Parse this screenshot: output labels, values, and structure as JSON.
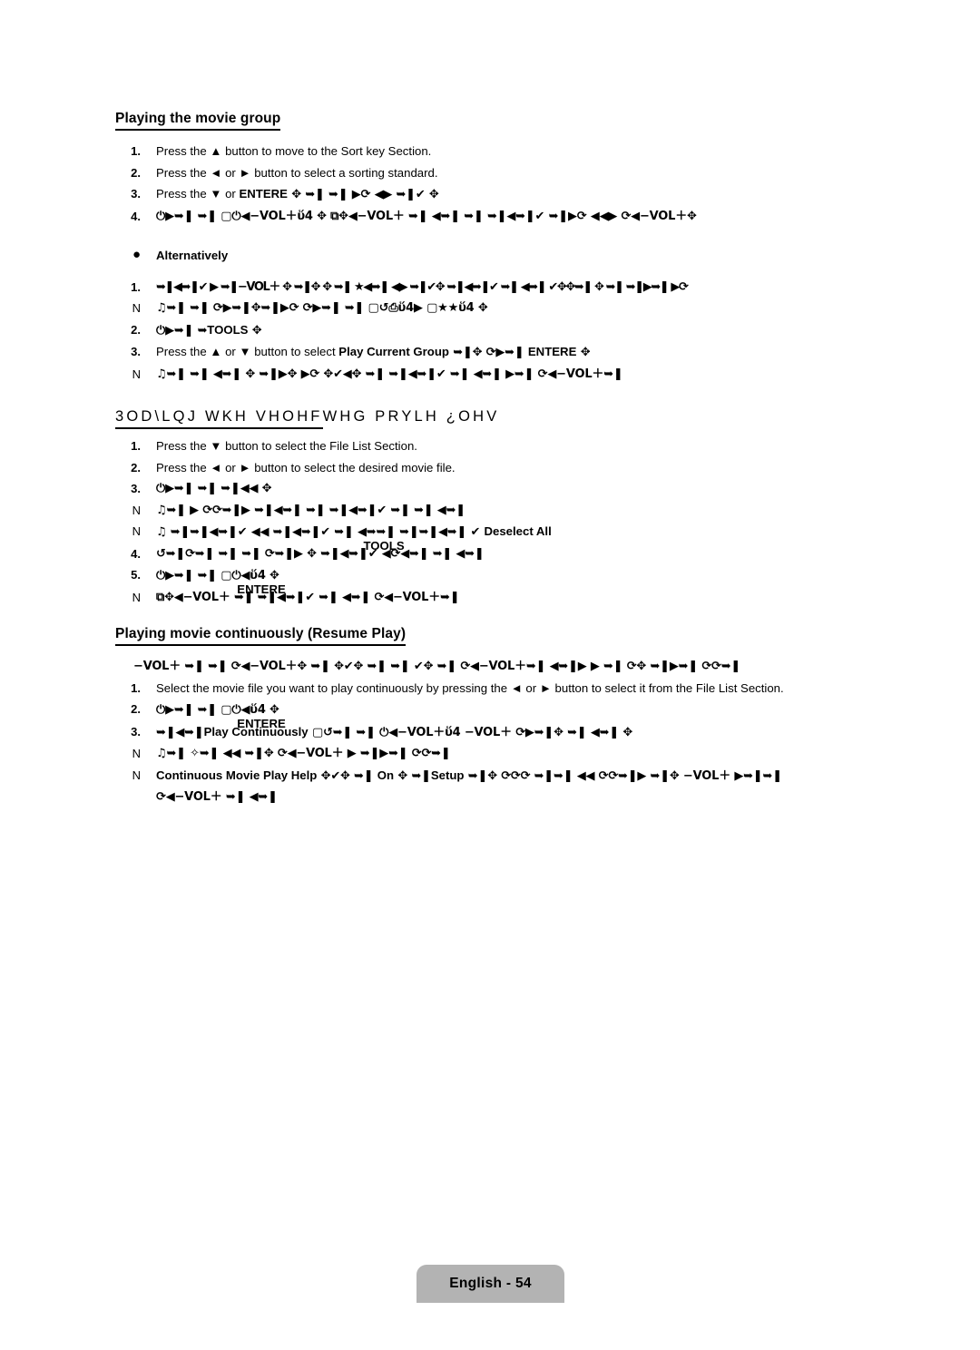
{
  "document": {
    "page_label": "English - 54",
    "background_color": "#ffffff",
    "text_color": "#000000",
    "footer_badge_color": "#b3b3b3"
  },
  "sections": [
    {
      "heading": "Playing the movie group",
      "heading_style": "normal",
      "items": [
        {
          "marker": "1.",
          "text": "Press the ▲ button to move to the Sort key Section."
        },
        {
          "marker": "2.",
          "text": "Press the ◄ or ► button to select a sorting standard."
        },
        {
          "marker": "3.",
          "text": "Press the ▼ or ",
          "bold": "ENTERE",
          "symbols": "  ✥  ➥❚ ➥❚ ▶⟳ ◀▶ ➥❚✔ ✥"
        },
        {
          "marker": "4.",
          "symbols": "⏻▶➥❚ ➥❚   ▢⏻◀−VOL＋ὕ4 ✥ ⧉✥◀−VOL＋ ➥❚ ◀➥❚ ➥❚ ➥❚◀➥❚✔ ➥❚▶⟳ ◀◀▶ ⟳◀−VOL＋✥"
        }
      ]
    },
    {
      "bullet": "Alternatively",
      "items": [
        {
          "marker": "1.",
          "symbols": "➥❚◀➥❚✔ ▶ ➥❚−VOL＋ ✥ ➥❚✥ ✥ ➥❚ ★◀➥❚ ◀▶ ➥❚✔✥ ➥❚◀➥❚✔ ➥❚ ◀➥❚ ✔✥✥➥❚ ✥ ➥❚ ➥❚▶➥❚ ▶⟳",
          "note": "♫➥❚ ➥❚ ⟳▶➥❚✥➥❚▶⟳ ⟳▶➥❚ ➥❚      ▢↺⎙ὕ4▶ ▢★★ὕ4 ✥"
        },
        {
          "marker": "2.",
          "symbols": "⏻▶➥❚ ➥",
          "bold": "TOOLS",
          "symbols_after": " ✥"
        },
        {
          "marker": "3.",
          "text": "Press the ▲ or ▼ button to select ",
          "bold": "Play Current Group",
          "symbols": " ➥❚✥ ⟳▶➥❚ ",
          "bold2": "ENTERE",
          "symbols2": "  ✥",
          "note": "♫➥❚ ➥❚ ◀➥❚ ✥ ➥❚▶✥ ▶⟳ ✥✔◀✥ ➥❚ ➥❚◀➥❚✔ ➥❚ ◀➥❚ ▶➥❚ ⟳◀−VOL＋➥❚"
        }
      ]
    },
    {
      "heading": "3OD\\LQJ WKH VHOHFWHG PRYLH ¿OHV",
      "heading_underline_part": "3OD\\LQJ WKH VHOHF",
      "heading_plain_part": "WHG PRYLH ¿OHV",
      "heading_style": "garbled",
      "items": [
        {
          "marker": "1.",
          "text": "Press the ▼ button to select the File List Section."
        },
        {
          "marker": "2.",
          "text": "Press the ◄ or ► button to select the desired movie file."
        },
        {
          "marker": "3.",
          "symbols": "⏻▶➥❚ ➥❚ ➥❚◀◀ ✥",
          "note": "♫➥❚  ▶ ⟳⟳➥❚▶ ➥❚◀➥❚ ➥❚ ➥❚◀➥❚✔ ➥❚ ➥❚ ◀➥❚",
          "note2": "♫ ➥❚➥❚◀➥❚✔ ◀◀ ➥❚◀➥❚✔ ➥❚ ◀➥",
          "note2_overlap": "TOOLS",
          "note2_tail": "➥❚ ➥❚➥❚◀➥❚ ✔ ",
          "note2_bold": "Deselect All"
        },
        {
          "marker": "4.",
          "symbols": "↺➥❚⟳➥❚ ➥❚ ➥❚ ⟳➥❚▶ ✥ ➥❚◀➥❚✔ ◀⟳◀➥❚ ➥❚ ◀➥❚"
        },
        {
          "marker": "5.",
          "symbols": "⏻▶➥❚ ➥❚   ▢⏻◀",
          "bold_overlap": "ENTERE",
          "symbols_after": "ὕ4 ✥",
          "note": "⧉✥◀−VOL＋ ➥❚ ➥❚◀➥❚✔ ➥❚ ◀➥❚ ⟳◀−VOL＋➥❚"
        }
      ]
    },
    {
      "heading": "Playing movie continuously (Resume Play)",
      "heading_style": "normal",
      "lead_symbols": "−VOL＋ ➥❚ ➥❚ ⟳◀−VOL＋✥ ➥❚ ✥✔✥ ➥❚ ➥❚ ✔✥ ➥❚ ⟳◀−VOL＋➥❚ ◀➥❚▶ ▶ ➥❚ ⟳✥ ➥❚▶➥❚  ⟳⟳➥❚",
      "items": [
        {
          "marker": "1.",
          "text": "Select the movie file you want to play continuously by pressing the ◄ or ► button to select it from the File List Section."
        },
        {
          "marker": "2.",
          "symbols": "⏻▶➥❚ ➥❚   ▢⏻◀",
          "bold_overlap": "ENTERE",
          "symbols_after": "ὕ4 ✥"
        },
        {
          "marker": "3.",
          "symbols": "➥❚◀➥❚",
          "bold": "Play Continuously",
          "symbols_after": " ▢↺➥❚ ➥❚ ⏻◀−VOL＋ὕ4 −VOL＋ ⟳▶➥❚✥ ➥❚ ◀➥❚ ✥",
          "note": "♫➥❚ ✧➥❚ ◀◀ ➥❚✥ ⟳◀−VOL＋ ▶ ➥❚▶➥❚  ⟳⟳➥❚",
          "note2_bold": "Continuous Movie Play Help",
          "note2_symbols": " ✥✔✥ ➥❚ ",
          "note2_bold2": "On",
          "note2_symbols2": " ✥ ➥❚",
          "note2_bold3": "Setup",
          "note2_symbols3": " ➥❚✥ ⟳⟳⟳ ➥❚➥❚ ◀◀ ⟳⟳➥❚▶ ➥❚✥ −VOL＋ ▶➥❚➥❚",
          "note3_symbols": "⟳◀−VOL＋ ➥❚ ◀➥❚"
        }
      ]
    }
  ]
}
